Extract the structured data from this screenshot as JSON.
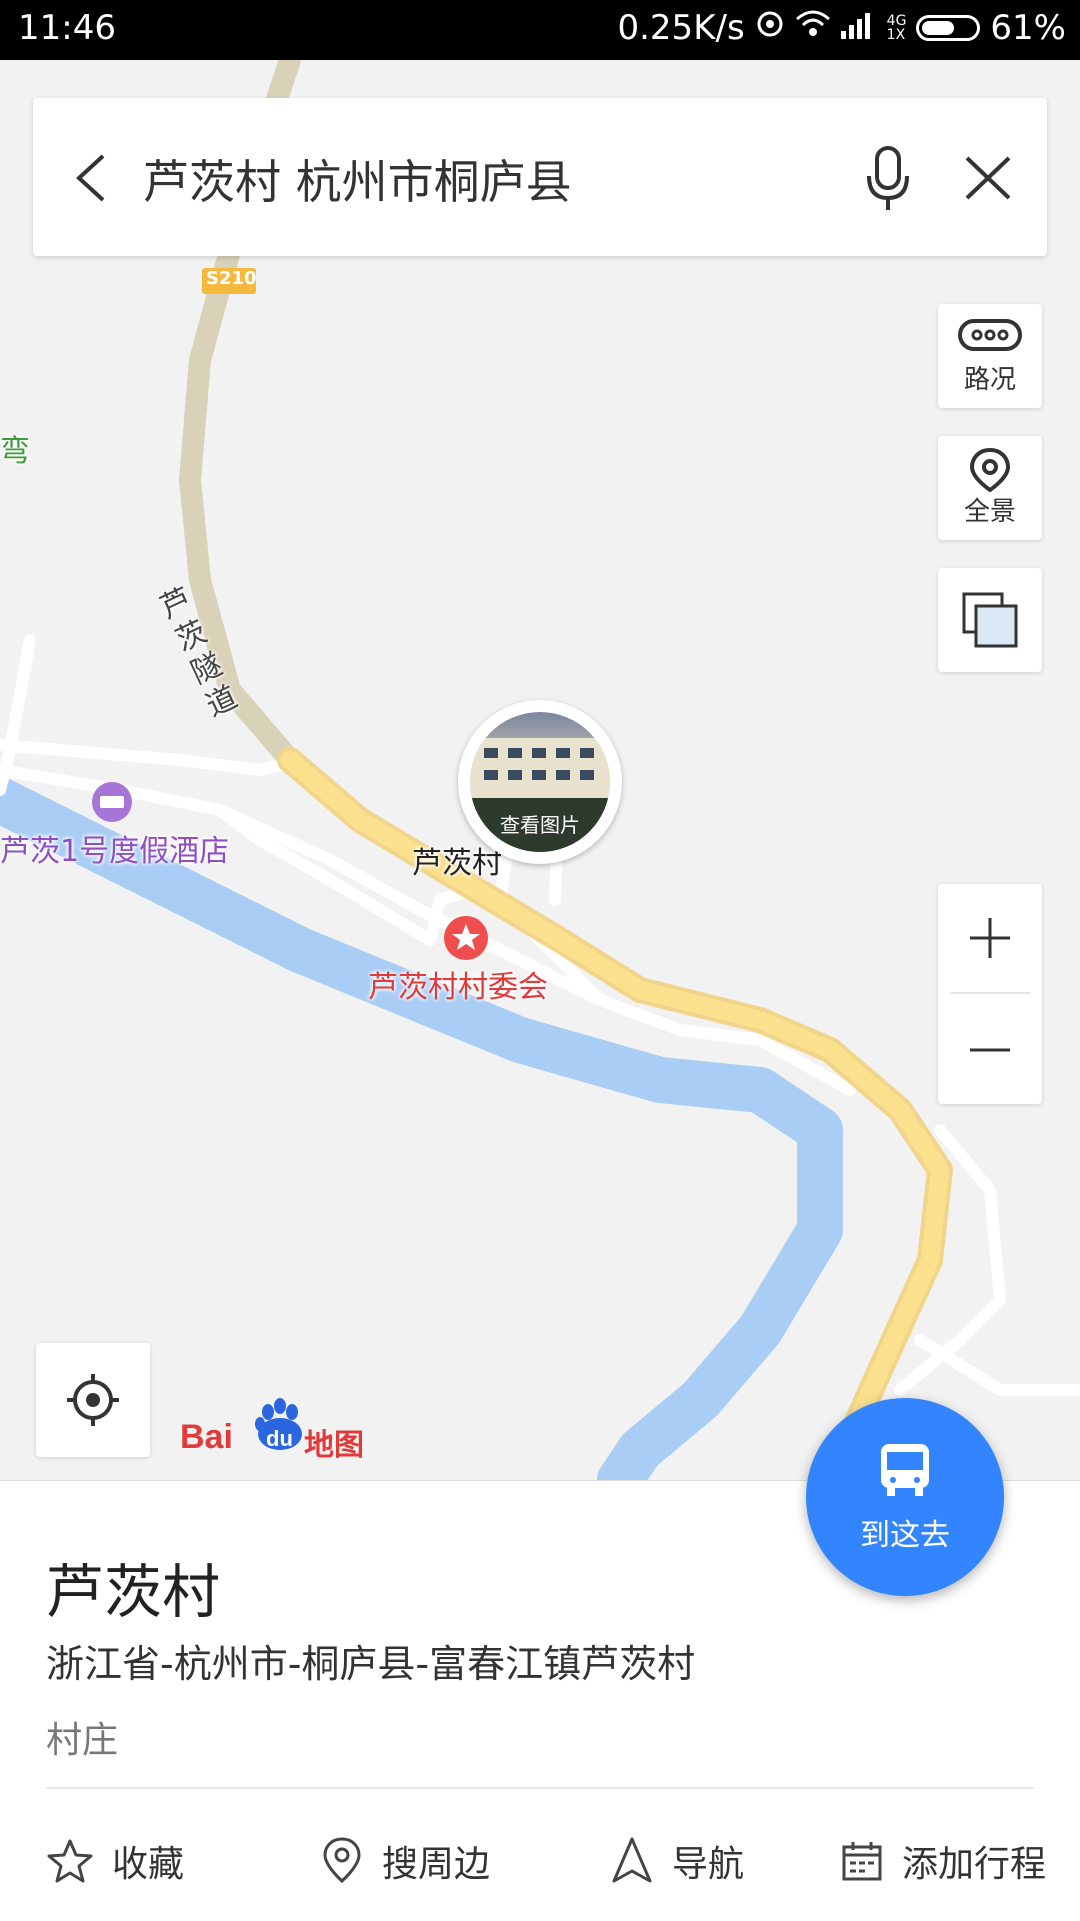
{
  "status_bar": {
    "time": "11:46",
    "network_speed": "0.25K/s",
    "network_type_top": "4G",
    "network_type_bottom": "1X",
    "battery": "61%",
    "battery_level": 0.61
  },
  "search": {
    "query": "芦茨村 杭州市桐庐县"
  },
  "tools": {
    "traffic_label": "路况",
    "panorama_label": "全景"
  },
  "map": {
    "road_badge": "S210",
    "tunnel_label": "芦茨隧道",
    "village_label": "芦茨村",
    "hotel_label": "芦茨1号度假酒店",
    "committee_label": "芦茨村村委会",
    "edge_label": "弯",
    "photo_caption": "查看图片",
    "logo_text_bai": "Bai",
    "logo_text_du": "du",
    "logo_text_map": "地图",
    "colors": {
      "background": "#f2f2f2",
      "highway": "#fbe08d",
      "tunnel": "#d8d2b8",
      "river": "#a9cdf5",
      "street": "#ffffff",
      "accent_blue": "#3385ff"
    }
  },
  "place": {
    "name": "芦茨村",
    "address": "浙江省-杭州市-桐庐县-富春江镇芦茨村",
    "type": "村庄"
  },
  "actions": {
    "favorite": "收藏",
    "nearby": "搜周边",
    "navigate": "导航",
    "add_trip": "添加行程"
  },
  "goto_button": {
    "label": "到这去"
  }
}
